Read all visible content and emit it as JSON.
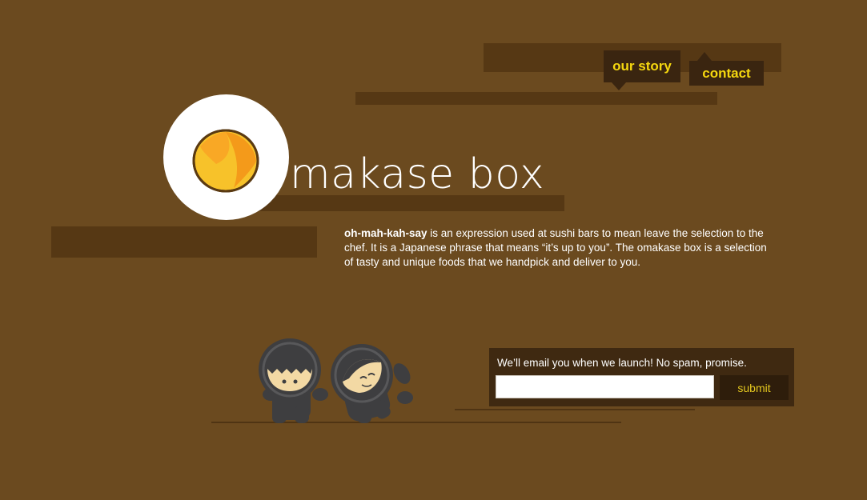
{
  "nav": {
    "items": [
      {
        "label": "our story"
      },
      {
        "label": "contact"
      }
    ]
  },
  "logo": {
    "text": "makase box",
    "emblem_icon": "orange-emblem-icon"
  },
  "intro": {
    "term": "oh-mah-kah-say",
    "body": " is an expression used at sushi bars to mean leave the selection to the chef.  It is a Japanese phrase that means “it’s up to you”.  The omakase box is a selection of tasty and unique foods that we handpick and deliver to you."
  },
  "signup": {
    "message": "We’ll email you when we launch! No spam, promise.",
    "input_value": "",
    "input_placeholder": "",
    "submit_label": "submit"
  },
  "colors": {
    "background": "#6b4a1f",
    "accent_yellow": "#f6d80f",
    "dark_brown": "#3a2510"
  }
}
